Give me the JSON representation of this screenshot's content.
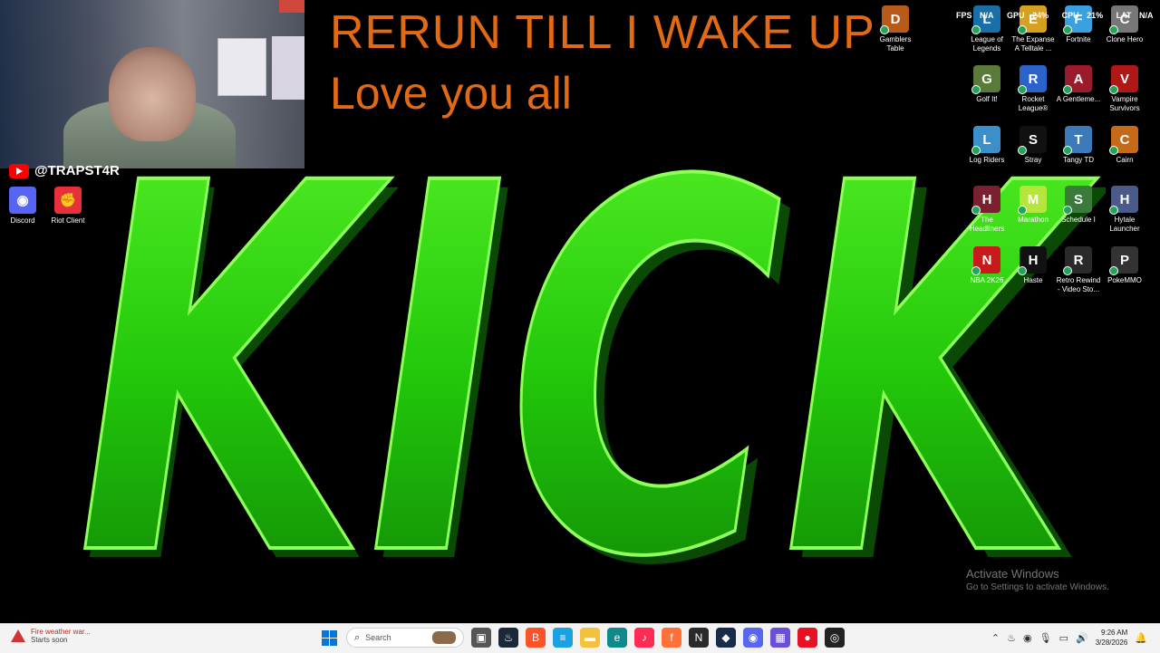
{
  "banner": {
    "line1": "RERUN TILL I WAKE UP",
    "line2": "Love you all"
  },
  "kick_text": "KICK",
  "social": {
    "handle": "@TRAPST4R"
  },
  "left_icons": [
    {
      "name": "discord-icon",
      "label": "Discord",
      "color": "#5865F2",
      "glyph": "◉"
    },
    {
      "name": "riot-client-icon",
      "label": "Riot Client",
      "color": "#e8303a",
      "glyph": "✊"
    }
  ],
  "perf_overlay": {
    "fps": "FPS",
    "fps_value": "N/A",
    "gpu": "GPU",
    "gpu_value": "24%",
    "cpu": "CPU",
    "cpu_value": "21%",
    "lat": "LAT",
    "lat_value": "N/A"
  },
  "right_icons": [
    {
      "label": "Gamblers Table",
      "color": "#b85a1a",
      "glyph": "D"
    },
    {
      "label": "League of Legends",
      "color": "#1b6fa8",
      "glyph": "L"
    },
    {
      "label": "The Expanse A Telltale ...",
      "color": "#d6a020",
      "glyph": "E"
    },
    {
      "label": "Fortnite",
      "color": "#3aa0e0",
      "glyph": "F"
    },
    {
      "label": "Clone Hero",
      "color": "#777777",
      "glyph": "C"
    },
    {
      "label": "Golf It!",
      "color": "#5a7a3a",
      "glyph": "G"
    },
    {
      "label": "Rocket League®",
      "color": "#2a63c9",
      "glyph": "R"
    },
    {
      "label": "A Gentleme...",
      "color": "#9a1b2b",
      "glyph": "A"
    },
    {
      "label": "Vampire Survivors",
      "color": "#b01818",
      "glyph": "V"
    },
    {
      "label": "Log Riders",
      "color": "#3d8fc9",
      "glyph": "L"
    },
    {
      "label": "Stray",
      "color": "#111111",
      "glyph": "S"
    },
    {
      "label": "Tangy TD",
      "color": "#3b79b8",
      "glyph": "T"
    },
    {
      "label": "Cairn",
      "color": "#c46a1a",
      "glyph": "C"
    },
    {
      "label": "The Headliners",
      "color": "#7a2030",
      "glyph": "H"
    },
    {
      "label": "Marathon",
      "color": "#b6e63c",
      "glyph": "M"
    },
    {
      "label": "Schedule I",
      "color": "#3a7a3a",
      "glyph": "S"
    },
    {
      "label": "Hytale Launcher",
      "color": "#4a5a8a",
      "glyph": "H"
    },
    {
      "label": "NBA 2K26",
      "color": "#c81a1a",
      "glyph": "N"
    },
    {
      "label": "Haste",
      "color": "#111111",
      "glyph": "H"
    },
    {
      "label": "Retro Rewind - Video Sto...",
      "color": "#2a2a2a",
      "glyph": "R"
    },
    {
      "label": "PokeMMO",
      "color": "#333333",
      "glyph": "P"
    }
  ],
  "watermark": {
    "title": "Activate Windows",
    "subtitle": "Go to Settings to activate Windows."
  },
  "taskbar": {
    "weather_title": "Fire weather war...",
    "weather_sub": "Starts soon",
    "search_placeholder": "Search",
    "apps": [
      {
        "name": "task-view",
        "color": "#555555",
        "glyph": "▣"
      },
      {
        "name": "steam",
        "color": "#1b2838",
        "glyph": "♨"
      },
      {
        "name": "brave",
        "color": "#fb542b",
        "glyph": "B"
      },
      {
        "name": "notepad",
        "color": "#1ba1e2",
        "glyph": "≡"
      },
      {
        "name": "file-explorer",
        "color": "#f3c13a",
        "glyph": "▬"
      },
      {
        "name": "edge",
        "color": "#0f8a8a",
        "glyph": "e"
      },
      {
        "name": "tiktok",
        "color": "#fe2c55",
        "glyph": "♪"
      },
      {
        "name": "firefox",
        "color": "#ff7139",
        "glyph": "f"
      },
      {
        "name": "nvidia",
        "color": "#2a2a2a",
        "glyph": "N"
      },
      {
        "name": "app-dark",
        "color": "#1a2a4a",
        "glyph": "◆"
      },
      {
        "name": "discord",
        "color": "#5865F2",
        "glyph": "◉"
      },
      {
        "name": "grid-app",
        "color": "#6b4fd8",
        "glyph": "▦"
      },
      {
        "name": "red-app",
        "color": "#e81123",
        "glyph": "●"
      },
      {
        "name": "obs",
        "color": "#222222",
        "glyph": "◎"
      }
    ],
    "time": "9:26 AM",
    "date": "3/28/2026"
  }
}
